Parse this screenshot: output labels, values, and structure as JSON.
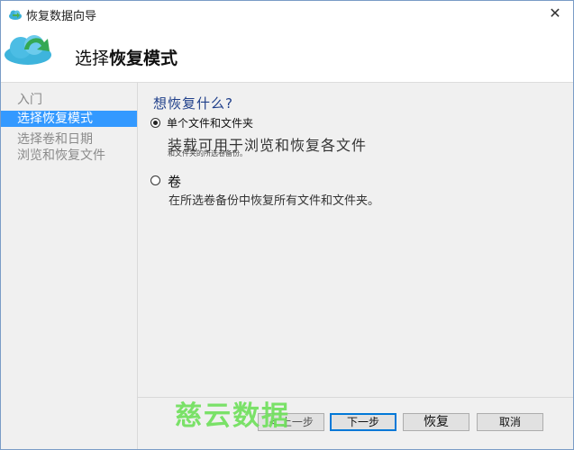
{
  "window": {
    "title": "恢复数据向导",
    "close_glyph": "✕"
  },
  "header": {
    "title_prefix": "选择",
    "title_strong": "恢复模式"
  },
  "sidebar": {
    "items": [
      {
        "label": "入门",
        "active": false
      },
      {
        "label": "选择恢复模式",
        "active": true
      },
      {
        "label": "选择卷和日期",
        "active": false
      },
      {
        "label": "浏览和恢复文件",
        "active": false
      }
    ]
  },
  "content": {
    "question": "想恢复什么?",
    "options": [
      {
        "label": "单个文件和文件夹",
        "checked": true,
        "desc_large": "装载可用于浏览和恢复各文件",
        "desc_small": "和文件夹的所选卷备份。"
      },
      {
        "label": "卷",
        "checked": false,
        "desc": "在所选卷备份中恢复所有文件和文件夹。"
      }
    ]
  },
  "buttons": {
    "back": "< 上一步",
    "next": "下一步",
    "recover": "恢复",
    "cancel": "取消"
  },
  "watermark": "慈云数据",
  "colors": {
    "selection": "#3399ff",
    "question": "#1f3f8a",
    "watermark": "#6ee05a"
  },
  "icons": {
    "title": "cloud-icon",
    "header": "cloud-sync-icon",
    "close": "close-icon"
  }
}
